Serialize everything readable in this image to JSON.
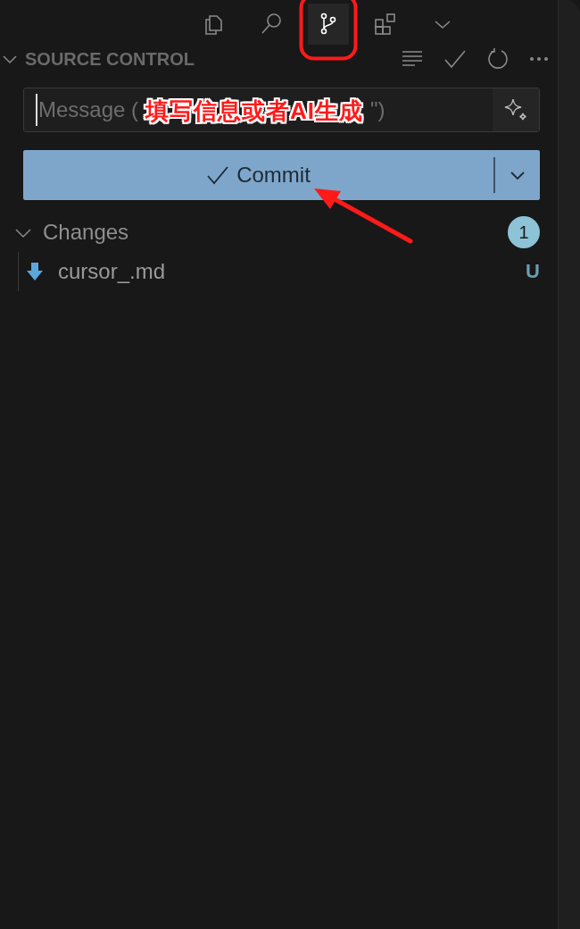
{
  "activity_bar": {
    "items": [
      {
        "kind": "files",
        "selected": false
      },
      {
        "kind": "search",
        "selected": false
      },
      {
        "kind": "source-control",
        "selected": true
      },
      {
        "kind": "extensions",
        "selected": false
      },
      {
        "kind": "more",
        "selected": false
      }
    ]
  },
  "panel": {
    "title": "SOURCE CONTROL",
    "expanded": true
  },
  "message_field": {
    "placeholder": "Message (",
    "placeholder_tail": "\")"
  },
  "commit_button": {
    "label": "Commit"
  },
  "changes": {
    "label": "Changes",
    "expanded": true,
    "count": "1",
    "files": [
      {
        "name": "cursor_.md",
        "status": "U"
      }
    ]
  },
  "annotation": {
    "label": "填写信息或者AI生成"
  }
}
